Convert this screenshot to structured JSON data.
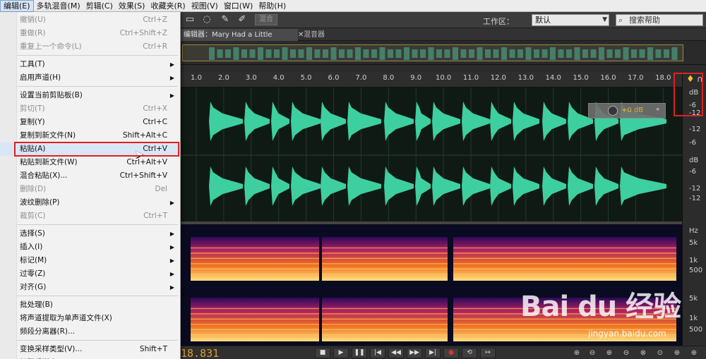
{
  "menubar": {
    "items": [
      "编辑(E)",
      "多轨混音(M)",
      "剪辑(C)",
      "效果(S)",
      "收藏夹(R)",
      "视图(V)",
      "窗口(W)",
      "帮助(H)"
    ],
    "active_index": 0
  },
  "toolbar": {
    "mix_button": "混合",
    "workspace_label": "工作区：",
    "workspace_value": "默认",
    "search_placeholder": "搜索帮助"
  },
  "tabs": {
    "editor": "编辑器：Mary Had a Little Lamb.wav",
    "mixer": "混音器"
  },
  "ruler": {
    "labels": [
      "1.0",
      "2.0",
      "3.0",
      "4.0",
      "5.0",
      "6.0",
      "7.0",
      "8.0",
      "9.0",
      "10.0",
      "11.0",
      "12.0",
      "13.0",
      "14.0",
      "15.0",
      "16.0",
      "17.0",
      "18.0"
    ]
  },
  "scale": {
    "db_unit": "dB",
    "db_labels": [
      "-6",
      "-12",
      "-12",
      "-6",
      "dB",
      "-6",
      "-12",
      "-12"
    ],
    "hz_unit": "Hz",
    "hz_labels": [
      "5k",
      "1k",
      "500",
      "5k",
      "1k",
      "500"
    ]
  },
  "hud": {
    "value": "+0 dB"
  },
  "transport": {
    "timecode": "18.831"
  },
  "edit_menu": {
    "items": [
      {
        "label": "撤销(U)",
        "shortcut": "Ctrl+Z",
        "disabled": true
      },
      {
        "label": "重做(R)",
        "shortcut": "Ctrl+Shift+Z",
        "disabled": true
      },
      {
        "label": "重复上一个命令(L)",
        "shortcut": "Ctrl+R",
        "disabled": true
      },
      {
        "label": "工具(T)",
        "submenu": true
      },
      {
        "label": "启用声道(H)",
        "submenu": true
      },
      {
        "label": "设置当前剪贴板(B)",
        "submenu": true
      },
      {
        "label": "剪切(T)",
        "shortcut": "Ctrl+X",
        "disabled": true
      },
      {
        "label": "复制(Y)",
        "shortcut": "Ctrl+C"
      },
      {
        "label": "复制到新文件(N)",
        "shortcut": "Shift+Alt+C"
      },
      {
        "label": "粘贴(A)",
        "shortcut": "Ctrl+V",
        "highlighted": true
      },
      {
        "label": "粘贴到新文件(W)",
        "shortcut": "Ctrl+Alt+V"
      },
      {
        "label": "混合粘贴(X)...",
        "shortcut": "Ctrl+Shift+V"
      },
      {
        "label": "删除(D)",
        "shortcut": "Del",
        "disabled": true
      },
      {
        "label": "波纹删除(P)",
        "submenu": true
      },
      {
        "label": "裁剪(C)",
        "shortcut": "Ctrl+T",
        "disabled": true
      },
      {
        "label": "选择(S)",
        "submenu": true
      },
      {
        "label": "插入(I)",
        "submenu": true
      },
      {
        "label": "标记(M)",
        "submenu": true
      },
      {
        "label": "过零(Z)",
        "submenu": true
      },
      {
        "label": "对齐(G)",
        "submenu": true
      },
      {
        "label": "批处理(B)"
      },
      {
        "label": "将声道提取为单声道文件(X)"
      },
      {
        "label": "频段分离器(R)..."
      },
      {
        "label": "变换采样类型(V)...",
        "shortcut": "Shift+T"
      },
      {
        "label": "解释采样率(..."
      }
    ]
  },
  "colors": {
    "waveform": "#3ecfa0",
    "accent_red": "#e02020",
    "timecode": "#d8a030",
    "menu_highlight": "#d9e6f5"
  },
  "watermark": {
    "brand": "Bai du 经验",
    "url": "jingyan.baidu.com"
  }
}
